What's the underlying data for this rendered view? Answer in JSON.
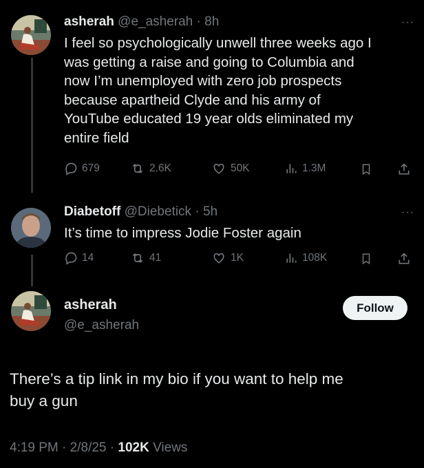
{
  "tweet1": {
    "display_name": "asherah",
    "handle": "@e_asherah",
    "time": "8h",
    "text_lines": [
      "I feel so psychologically unwell three weeks ago I",
      "was getting a raise and going to Columbia and",
      "now I’m unemployed with zero job prospects",
      "because apartheid Clyde and his army of",
      "YouTube educated 19 year olds eliminated my",
      "entire field"
    ],
    "replies": "679",
    "reposts": "2.6K",
    "likes": "50K",
    "views": "1.3M"
  },
  "tweet2": {
    "display_name": "Diabetoff",
    "handle": "@Diebetick",
    "time": "5h",
    "text": "It’s time to impress Jodie Foster again",
    "replies": "14",
    "reposts": "41",
    "likes": "1K",
    "views": "108K"
  },
  "main_tweet": {
    "display_name": "asherah",
    "handle": "@e_asherah",
    "follow_label": "Follow",
    "text_lines": [
      "There’s a tip link in my bio if you want to help me",
      "buy a gun"
    ],
    "time": "4:19 PM",
    "date": "2/8/25",
    "views_count": "102K",
    "views_label": "Views"
  },
  "separator": " · ",
  "more_glyph": "···",
  "icons": [
    "reply-icon",
    "repost-icon",
    "like-icon",
    "views-icon",
    "bookmark-icon",
    "share-icon",
    "more-icon"
  ]
}
